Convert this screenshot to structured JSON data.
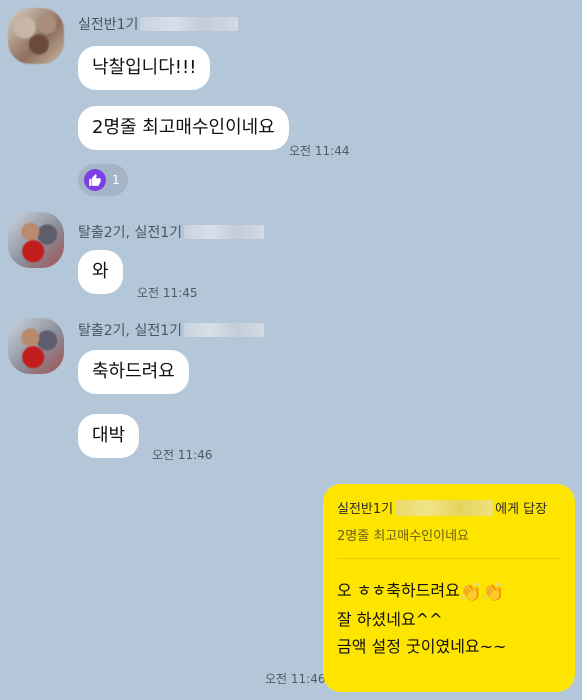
{
  "messages": [
    {
      "sender": "실전반1기",
      "bubbles": [
        "낙찰입니다!!!",
        "2명줄 최고매수인이네요"
      ],
      "time": "오전 11:44",
      "reaction": {
        "icon": "thumbs-up-icon",
        "count": "1",
        "color": "#7c3fe4"
      }
    },
    {
      "sender": "탈출2기, 실전1기",
      "bubbles": [
        "와"
      ],
      "time": "오전 11:45"
    },
    {
      "sender": "탈출2기, 실전1기",
      "bubbles": [
        "축하드려요",
        "대박"
      ],
      "time": "오전 11:46"
    }
  ],
  "reply": {
    "to_prefix": "실전반1기",
    "to_suffix": "에게 답장",
    "quote": "2명줄 최고매수인이네요",
    "lines": [
      "오 ㅎㅎ축하드려요",
      "잘 하셨네요^^",
      "금액 설정 굿이였네요~~"
    ],
    "emoji": "👏",
    "time": "오전 11:46",
    "bubble_color": "#fee500"
  },
  "colors": {
    "background": "#b4c7d9",
    "other_bubble": "#ffffff"
  }
}
